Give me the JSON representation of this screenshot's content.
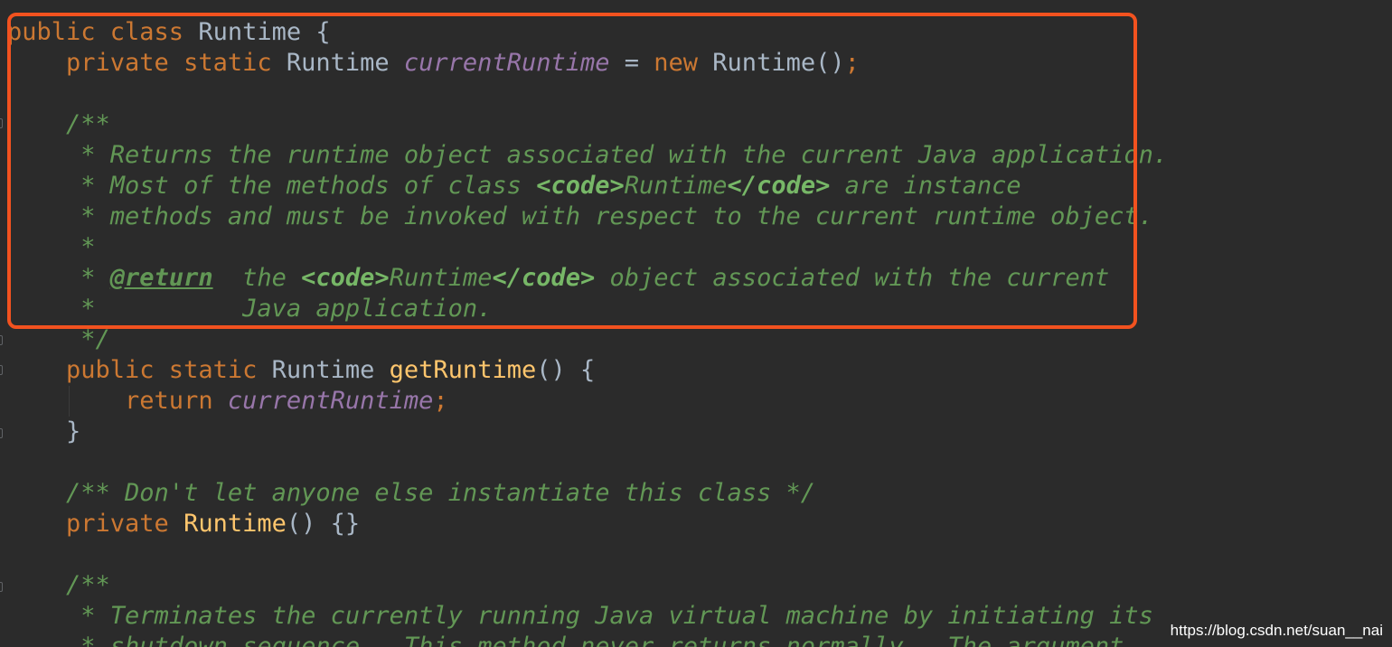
{
  "lines": [
    [
      {
        "t": "public class ",
        "c": "kw"
      },
      {
        "t": "Runtime ",
        "c": "ty"
      },
      {
        "t": "{",
        "c": "op"
      }
    ],
    [
      {
        "t": "    private static ",
        "c": "kw"
      },
      {
        "t": "Runtime ",
        "c": "ty"
      },
      {
        "t": "currentRuntime",
        "c": "field"
      },
      {
        "t": " = ",
        "c": "op"
      },
      {
        "t": "new ",
        "c": "kw"
      },
      {
        "t": "Runtime",
        "c": "ty"
      },
      {
        "t": "()",
        "c": "op"
      },
      {
        "t": ";",
        "c": "punct"
      }
    ],
    [],
    [
      {
        "t": "    /**",
        "c": "doc"
      }
    ],
    [
      {
        "t": "     * Returns the runtime object associated with the current Java application.",
        "c": "doc"
      }
    ],
    [
      {
        "t": "     * Most of the methods of class ",
        "c": "doc"
      },
      {
        "t": "<code>",
        "c": "doc-markup"
      },
      {
        "t": "Runtime",
        "c": "doc"
      },
      {
        "t": "</code>",
        "c": "doc-markup"
      },
      {
        "t": " are instance",
        "c": "doc"
      }
    ],
    [
      {
        "t": "     * methods and must be invoked with respect to the current runtime object.",
        "c": "doc"
      }
    ],
    [
      {
        "t": "     *",
        "c": "doc"
      }
    ],
    [
      {
        "t": "     * ",
        "c": "doc"
      },
      {
        "t": "@return",
        "c": "doc-tag"
      },
      {
        "t": "  the ",
        "c": "doc"
      },
      {
        "t": "<code>",
        "c": "doc-markup"
      },
      {
        "t": "Runtime",
        "c": "doc"
      },
      {
        "t": "</code>",
        "c": "doc-markup"
      },
      {
        "t": " object associated with the current",
        "c": "doc"
      }
    ],
    [
      {
        "t": "     *          Java application.",
        "c": "doc"
      }
    ],
    [
      {
        "t": "     */",
        "c": "doc"
      }
    ],
    [
      {
        "t": "    public static ",
        "c": "kw"
      },
      {
        "t": "Runtime ",
        "c": "ty"
      },
      {
        "t": "getRuntime",
        "c": "fn"
      },
      {
        "t": "() {",
        "c": "op"
      }
    ],
    [
      {
        "t": "        return ",
        "c": "kw"
      },
      {
        "t": "currentRuntime",
        "c": "field"
      },
      {
        "t": ";",
        "c": "punct"
      }
    ],
    [
      {
        "t": "    }",
        "c": "op"
      }
    ],
    [],
    [
      {
        "t": "    /** Don't let anyone else instantiate this class */",
        "c": "doc"
      }
    ],
    [
      {
        "t": "    private ",
        "c": "kw"
      },
      {
        "t": "Runtime",
        "c": "fn"
      },
      {
        "t": "() {}",
        "c": "op"
      }
    ],
    [],
    [
      {
        "t": "    /**",
        "c": "doc"
      }
    ],
    [
      {
        "t": "     * Terminates the currently running Java virtual machine by initiating its",
        "c": "doc"
      }
    ],
    [
      {
        "t": "     * shutdown sequence.  This method never returns normally.  The argument",
        "c": "doc"
      }
    ]
  ],
  "watermark": "https://blog.csdn.net/suan__nai",
  "colors": {
    "background": "#2b2b2b",
    "keyword": "#cc7832",
    "type": "#a9b7c6",
    "method": "#ffc66d",
    "field": "#9876aa",
    "doc_comment": "#629755",
    "highlight_box": "#f2521f"
  }
}
